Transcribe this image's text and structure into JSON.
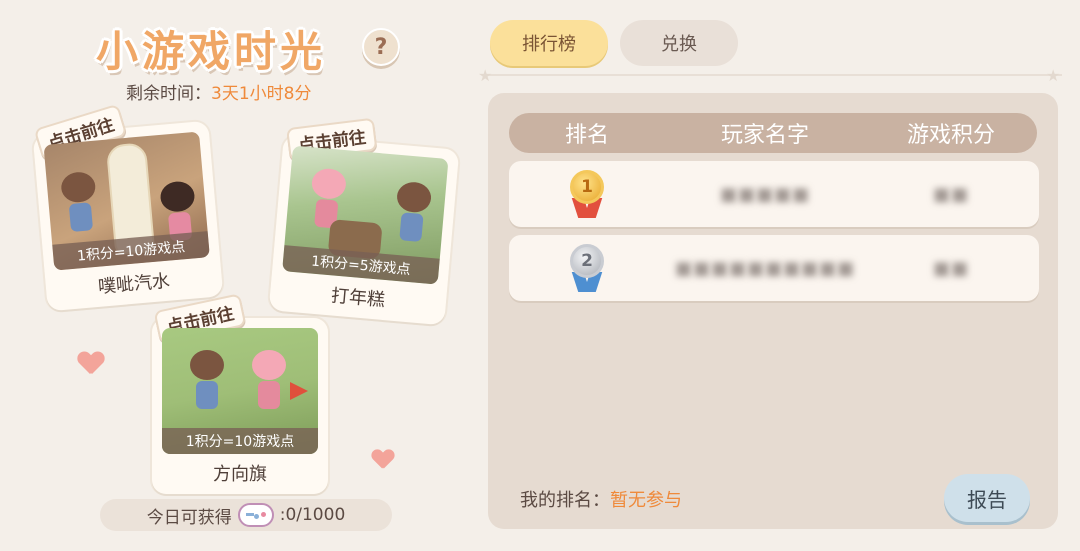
{
  "header": {
    "title": "小游戏时光",
    "help_symbol": "?",
    "remaining_label": "剩余时间：",
    "remaining_value": "3天1小时8分"
  },
  "games": [
    {
      "tag": "点击前往",
      "points": "1积分=10游戏点",
      "name": "噗呲汽水"
    },
    {
      "tag": "点击前往",
      "points": "1积分=5游戏点",
      "name": "打年糕"
    },
    {
      "tag": "点击前往",
      "points": "1积分=10游戏点",
      "name": "方向旗"
    }
  ],
  "daily": {
    "label": "今日可获得",
    "icon": "gamepad-icon",
    "value": ":0/1000"
  },
  "tabs": [
    {
      "label": "排行榜",
      "active": true
    },
    {
      "label": "兑换",
      "active": false
    }
  ],
  "leaderboard": {
    "columns": [
      "排名",
      "玩家名字",
      "游戏积分"
    ],
    "rows": [
      {
        "rank": "1",
        "name": "■■■■■",
        "score": "■■"
      },
      {
        "rank": "2",
        "name": "■■■■■■■■■■",
        "score": "■■"
      }
    ]
  },
  "footer": {
    "my_rank_label": "我的排名：",
    "my_rank_value": "暂无参与",
    "report_label": "报告"
  },
  "colors": {
    "accent_orange": "#ef8a3b",
    "tab_active": "#fbe09a",
    "report_button": "#cfe0ea"
  }
}
